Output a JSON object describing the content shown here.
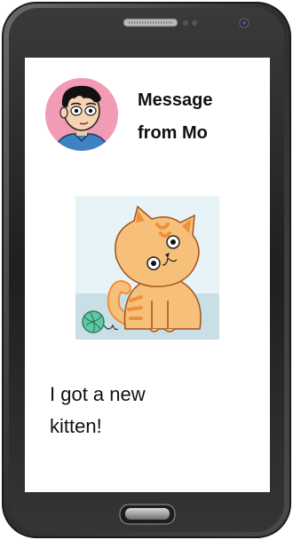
{
  "message": {
    "title_line1": "Message",
    "title_line2": "from Mo",
    "body_line1": "I got a new",
    "body_line2": "kitten!"
  },
  "colors": {
    "phone_body": "#3b3b3b",
    "avatar_bg": "#f29bb4",
    "cat_fur": "#f7c07a",
    "cat_stripe": "#f08f3b",
    "yarn": "#5fc9a6"
  },
  "icons": [
    "avatar-icon",
    "kitten-image",
    "home-button-icon",
    "speaker-icon",
    "front-camera-icon"
  ]
}
